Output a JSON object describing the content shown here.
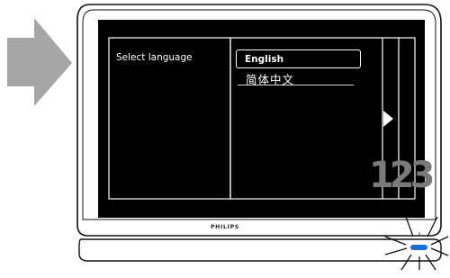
{
  "menu": {
    "heading": "Select language",
    "options": [
      {
        "label": "English",
        "selected": true
      },
      {
        "label": "简体中文",
        "selected": false
      }
    ]
  },
  "tv": {
    "brand": "PHILIPS",
    "overlay_number": "123",
    "power_indicator_color": "#1e6fd9"
  },
  "colors": {
    "screen": "#000000",
    "menu_line": "#ffffff",
    "arrow": "#a6a6a6",
    "bezel": "#ffffff"
  }
}
